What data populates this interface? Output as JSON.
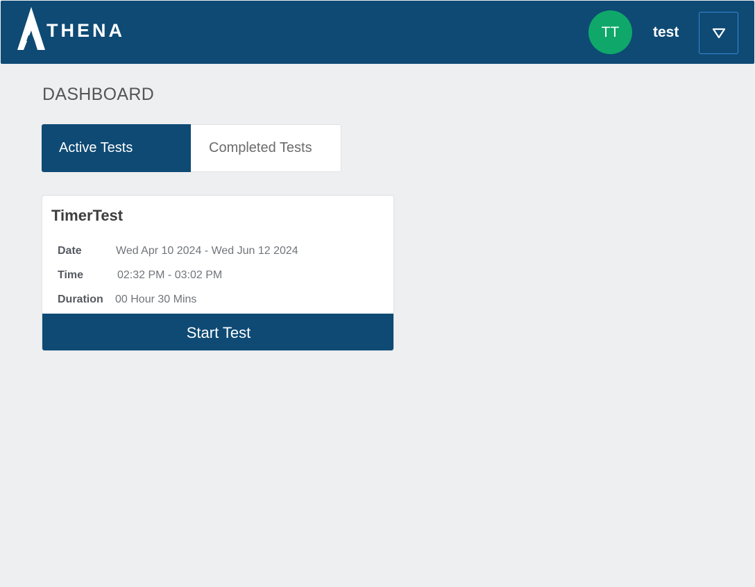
{
  "header": {
    "logo_text": "THENA",
    "avatar_initials": "TT",
    "username": "test",
    "menu_icon": "triangle-down-icon",
    "colors": {
      "bar": "#0e4a74",
      "avatar": "#0fa86a"
    }
  },
  "page": {
    "title": "DASHBOARD"
  },
  "tabs": [
    {
      "label": "Active Tests",
      "active": true
    },
    {
      "label": "Completed Tests",
      "active": false
    }
  ],
  "test_card": {
    "title": "TimerTest",
    "details": {
      "date_label": "Date",
      "date_value": "Wed Apr 10 2024 - Wed Jun 12 2024",
      "time_label": "Time",
      "time_value": "02:32 PM - 03:02 PM",
      "duration_label": "Duration",
      "duration_value": "00 Hour 30 Mins"
    },
    "button_label": "Start Test"
  }
}
